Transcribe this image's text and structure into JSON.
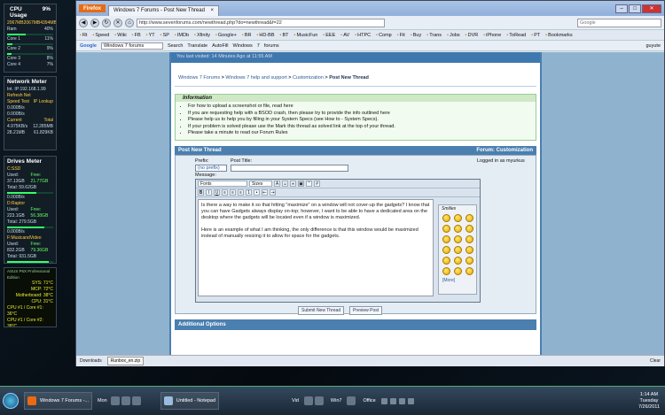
{
  "gadgets": {
    "cpu": {
      "title": "CPU Usage",
      "percent": "9%",
      "headers": [
        "Total",
        "Free",
        "Total"
      ],
      "rows": [
        [
          "2067MB",
          "2067MB",
          "4394MB"
        ],
        [
          "Ram",
          "",
          "40%"
        ],
        [
          "Core 1",
          "",
          "11%"
        ],
        [
          "Core 2",
          "",
          "9%"
        ],
        [
          "Core 3",
          "",
          "8%"
        ],
        [
          "Core 4",
          "",
          "7%"
        ]
      ],
      "levels": [
        0.4,
        0.11,
        0.09,
        0.08,
        0.07
      ]
    },
    "network": {
      "title": "Network Meter",
      "ip_label": "Int. IP:192.168.1.99",
      "refresh": "Refresh Net",
      "speed": "Speed Test",
      "lookup": "IP Lookup",
      "rows": [
        [
          "0.000B/s",
          ""
        ],
        [
          "0.000B/s",
          ""
        ],
        [
          "Current",
          "Total"
        ],
        [
          "4.975KB/s",
          "12.285MB"
        ],
        [
          "28.21MB",
          "61.829KB"
        ]
      ]
    },
    "drives": {
      "title": "Drives Meter",
      "drives": [
        {
          "name": "C:SSD",
          "used": "Used: 37.13GB",
          "free": "Free: 21.77GB",
          "total": "Total: 59.62GB",
          "rate": "0.000B/s",
          "level": 0.63
        },
        {
          "name": "D:Raptor",
          "used": "Used: 223.1GB",
          "free": "Free: 56.38GB",
          "total": "Total: 279.5GB",
          "rate": "0.000B/s",
          "level": 0.8
        },
        {
          "name": "F:MusicandVideo",
          "used": "Used: 832.2GB",
          "free": "Free: 79.36GB",
          "total": "Total: 931.5GB",
          "rate": "0.000B/s",
          "level": 0.91
        },
        {
          "name": "H:VideoDump",
          "used": "Used: 1.164TB",
          "free": "Free: 204.3GB",
          "total": "Total: 1.365TB",
          "rate": "0.000B/s",
          "level": 0.85
        }
      ]
    },
    "temps": {
      "title": "ASUS P6X Professional Edition",
      "rows": [
        "SYS: 71°C",
        "MCP: 72°C",
        "Motherboard: 38°C",
        "CPU: 31°C",
        "CPU #1 / Core #1: 36°C",
        "CPU #1 / Core #2: 38°C",
        "CPU #1 / Core #3: 38°C",
        "CPU #1 / Core #4: 38°C",
        "GPU1 Diode: 54°C",
        "GPU2 Diode: 54°C"
      ]
    }
  },
  "browser": {
    "app_button": "Firefox",
    "tab_title": "Windows 7 Forums - Post New Thread",
    "url": "http://www.sevenforums.com/newthread.php?do=newthread&f=22",
    "search_placeholder": "Google",
    "bookmarks": [
      "Rt",
      "Speed",
      "Wiki",
      "FB",
      "YT",
      "SP",
      "IMDb",
      "Xfinity",
      "Google+",
      "BR",
      "HD-BB",
      "BT",
      "MusicFun",
      "EEE",
      "AV",
      "HTPC",
      "Comp",
      "Fit",
      "Buy",
      "Trans",
      "Jobs",
      "DVR",
      "iPhone",
      "ToRead",
      "PT",
      "Bookmarks"
    ],
    "toolbar2": {
      "google": "Google",
      "search_value": "Windows 7 forums",
      "search_btn": "Search",
      "translate": "Translate",
      "autofill": "AutoFill",
      "windows": "Windows",
      "seven": "7",
      "forums": "forums",
      "user": "guyute"
    }
  },
  "page": {
    "last_visited": "You last visited: 14 Minutes Ago at 11:55 AM",
    "breadcrumb": {
      "home": "Windows 7 Forums",
      "sep1": " > ",
      "sec": "Windows 7 help and support",
      "sep2": " > ",
      "sub": "Customization",
      "sep3": " > ",
      "current": "Post New Thread"
    },
    "info": {
      "heading": "Information",
      "items": [
        "For how to upload a screenshot or file, read here",
        "If you are requesting help with a BSOD crash, then please try to provide the info outlined here",
        "Please help us to help you by filling in your System Specs (see How to - System Specs).",
        "If your problem is solved please use the Mark this thread as solved link at the top of your thread.",
        "Please take a minute to read our Forum Rules"
      ]
    },
    "post_header": "Post New Thread",
    "forum_label": "Forum: Customization",
    "prefix_label": "Prefix:",
    "prefix_value": "(no prefix)",
    "title_label": "Post Title:",
    "title_value": "",
    "logged_in": "Logged in as myurkus",
    "message_label": "Message:",
    "font_dd": "Fonts",
    "size_dd": "Sizes",
    "message_p1": "Is there a way to make it so that hitting \"maximize\" on a window will not cover-up the gadgets? I know that you can have Gadgets always display on-top; however, I want to be able to have a dedicated area on the desktop where the gadgets will be located even if a window is maximized.",
    "message_p2": "Here is an example of what I am thinking, the only difference is that this window would be maximized instead of manually resizing it to allow for space for the gadgets.",
    "smilies_label": "Smilies",
    "smilies_more": "[More]",
    "submit": "Submit New Thread",
    "preview": "Preview Post",
    "additional": "Additional Options"
  },
  "bottom": {
    "downloads": "Downloads",
    "file": "Runbox_en.zip",
    "clear": "Clear"
  },
  "taskbar": {
    "items": [
      "Windows 7 Forums -...",
      "Untitled - Notepad"
    ],
    "labels": [
      "Mon",
      "Vid",
      "Win7"
    ],
    "office": "Office",
    "time": "1:14 AM",
    "day": "Tuesday",
    "date": "7/26/2011"
  }
}
